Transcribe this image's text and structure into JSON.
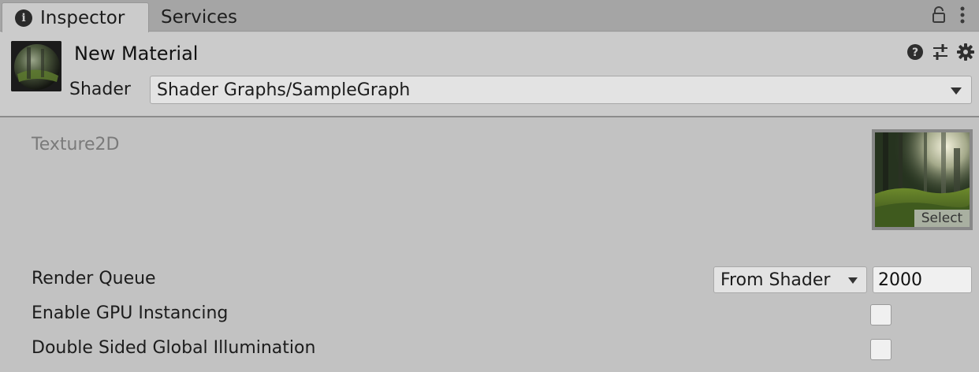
{
  "tabs": {
    "inspector_label": "Inspector",
    "services_label": "Services"
  },
  "icons": {
    "info": "info-circle-icon",
    "lock": "lock-icon",
    "more": "kebab-menu-icon",
    "help": "help-icon",
    "preset": "sliders-icon",
    "settings": "gear-icon",
    "dropdown": "chevron-down-icon"
  },
  "header": {
    "title": "New Material",
    "shader_label": "Shader",
    "shader_value": "Shader Graphs/SampleGraph"
  },
  "properties": {
    "texture_label": "Texture2D",
    "texture_select_label": "Select",
    "render_queue_label": "Render Queue",
    "render_queue_mode": "From Shader",
    "render_queue_value": "2000",
    "gpu_instancing_label": "Enable GPU Instancing",
    "gpu_instancing_checked": false,
    "double_sided_gi_label": "Double Sided Global Illumination",
    "double_sided_gi_checked": false
  },
  "colors": {
    "panel_bg": "#c2c2c2",
    "tabbar_bg": "#a5a5a5",
    "header_bg": "#cbcbcb",
    "field_bg": "#e3e3e3"
  }
}
